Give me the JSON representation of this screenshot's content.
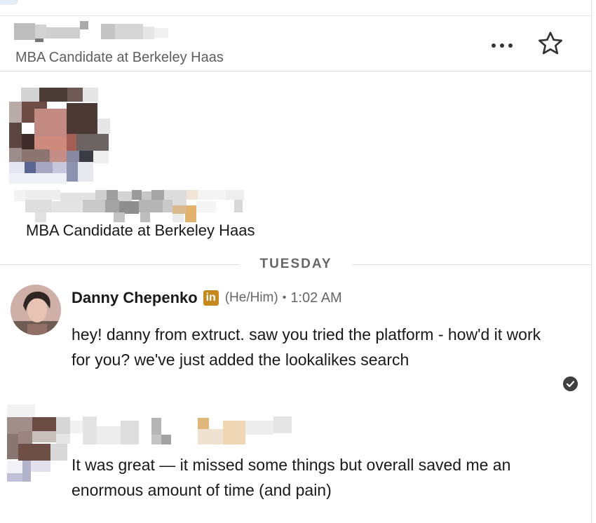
{
  "header": {
    "name": "",
    "headline": "MBA Candidate at Berkeley Haas",
    "more_icon": "more-horizontal-icon",
    "star_icon": "star-outline-icon"
  },
  "profile_card": {
    "name": "",
    "headline": "MBA Candidate at Berkeley Haas"
  },
  "day_divider": "TUESDAY",
  "messages": [
    {
      "sender": "Danny Chepenko",
      "badge": "in",
      "badge_color": "#c58a1e",
      "pronouns": "(He/Him)",
      "separator": "•",
      "time": "1:02 AM",
      "text": "hey! danny from extruct. saw you tried the platform - how'd it work for you? we've just added the lookalikes search",
      "status_icon": "seen-check-icon"
    },
    {
      "sender": "",
      "text": "It was great — it missed some things but overall saved me an enormous amount of time (and pain)"
    }
  ],
  "colors": {
    "text_primary": "#191919",
    "text_secondary": "#666666",
    "divider": "#e0e0e0",
    "premium_badge": "#c58a1e"
  }
}
